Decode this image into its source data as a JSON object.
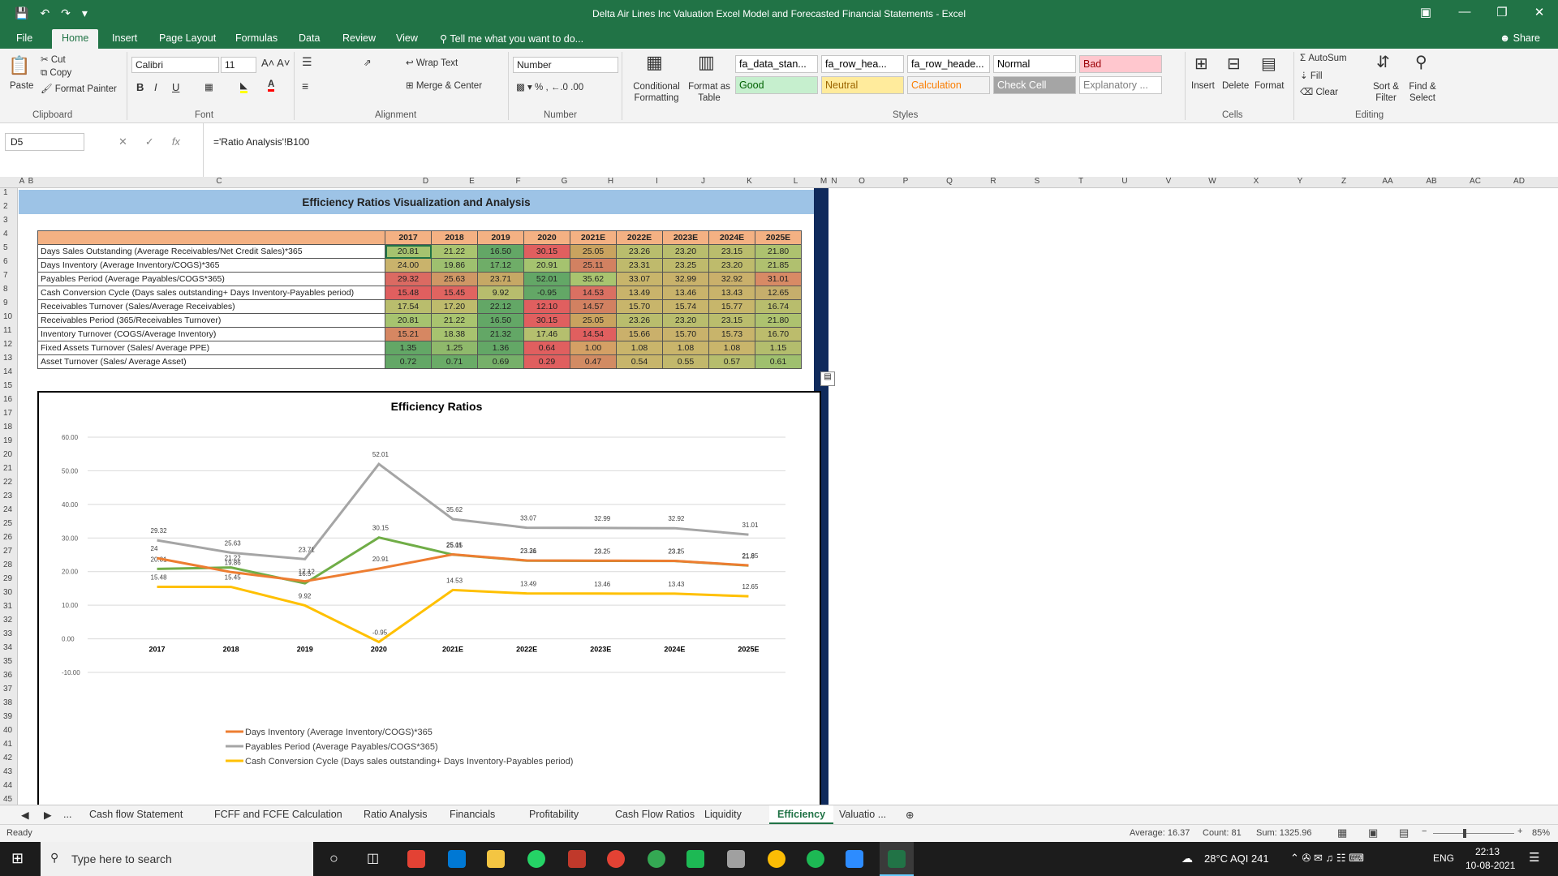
{
  "window": {
    "title": "Delta Air Lines Inc Valuation Excel Model and Forecasted Financial Statements - Excel"
  },
  "ribbon_tabs": [
    "File",
    "Home",
    "Insert",
    "Page Layout",
    "Formulas",
    "Data",
    "Review",
    "View"
  ],
  "tell_me": "Tell me what you want to do...",
  "share": "Share",
  "clipboard": {
    "paste": "Paste",
    "cut": "Cut",
    "copy": "Copy",
    "format_painter": "Format Painter",
    "group": "Clipboard"
  },
  "font": {
    "name": "Calibri",
    "size": "11",
    "group": "Font"
  },
  "alignment": {
    "wrap": "Wrap Text",
    "merge": "Merge & Center",
    "group": "Alignment"
  },
  "number": {
    "format": "Number",
    "group": "Number"
  },
  "styles": {
    "conditional": "Conditional Formatting",
    "format_table": "Format as Table",
    "group": "Styles",
    "cells": [
      {
        "label": "fa_data_stan...",
        "bg": "#ffffff",
        "fg": "#000000"
      },
      {
        "label": "fa_row_hea...",
        "bg": "#ffffff",
        "fg": "#000000"
      },
      {
        "label": "fa_row_heade...",
        "bg": "#ffffff",
        "fg": "#000000"
      },
      {
        "label": "Normal",
        "bg": "#ffffff",
        "fg": "#000000"
      },
      {
        "label": "Bad",
        "bg": "#ffc7ce",
        "fg": "#9c0006"
      },
      {
        "label": "Good",
        "bg": "#c6efce",
        "fg": "#006100"
      },
      {
        "label": "Neutral",
        "bg": "#ffeb9c",
        "fg": "#9c6500"
      },
      {
        "label": "Calculation",
        "bg": "#f2f2f2",
        "fg": "#fa7d00"
      },
      {
        "label": "Check Cell",
        "bg": "#a5a5a5",
        "fg": "#ffffff"
      },
      {
        "label": "Explanatory ...",
        "bg": "#ffffff",
        "fg": "#7f7f7f"
      }
    ]
  },
  "cells_group": {
    "insert": "Insert",
    "delete": "Delete",
    "format": "Format",
    "group": "Cells"
  },
  "editing": {
    "autosum": "AutoSum",
    "fill": "Fill",
    "clear": "Clear",
    "sort": "Sort & Filter",
    "find": "Find & Select",
    "group": "Editing"
  },
  "formula_bar": {
    "name_box": "D5",
    "formula": "='Ratio Analysis'!B100"
  },
  "columns": [
    "A",
    "B",
    "C",
    "D",
    "E",
    "F",
    "G",
    "H",
    "I",
    "J",
    "K",
    "L",
    "M",
    "N",
    "O",
    "P",
    "Q",
    "R",
    "S",
    "T",
    "U",
    "V",
    "W",
    "X",
    "Y",
    "Z",
    "AA",
    "AB",
    "AC",
    "AD"
  ],
  "rows": [
    "1",
    "2",
    "3",
    "4",
    "5",
    "6",
    "7",
    "8",
    "9",
    "10",
    "11",
    "12",
    "13",
    "14",
    "15",
    "16",
    "17",
    "18",
    "19",
    "20",
    "21",
    "22",
    "23",
    "24",
    "25",
    "26",
    "27",
    "28",
    "29",
    "30",
    "31",
    "32",
    "33",
    "34",
    "35",
    "36",
    "37",
    "38",
    "39",
    "40",
    "41",
    "42",
    "43",
    "44",
    "45"
  ],
  "sheet": {
    "banner": "Efficiency Ratios Visualization and Analysis",
    "years": [
      "2017",
      "2018",
      "2019",
      "2020",
      "2021E",
      "2022E",
      "2023E",
      "2024E",
      "2025E"
    ],
    "rows": [
      {
        "label": "Days Sales Outstanding (Average Receivables/Net Credit Sales)*365",
        "values": [
          "20.81",
          "21.22",
          "16.50",
          "30.15",
          "25.05",
          "23.26",
          "23.20",
          "23.15",
          "21.80"
        ],
        "colors": [
          "#a6c36f",
          "#a9c46f",
          "#63a766",
          "#e05f5f",
          "#c9a35f",
          "#b9bd6d",
          "#b9bd6d",
          "#babd6d",
          "#adc26f"
        ]
      },
      {
        "label": "Days Inventory  (Average Inventory/COGS)*365",
        "values": [
          "24.00",
          "19.86",
          "17.12",
          "20.91",
          "25.11",
          "23.31",
          "23.25",
          "23.20",
          "21.85"
        ],
        "colors": [
          "#c9b36c",
          "#9ec06f",
          "#6fad68",
          "#a5c36f",
          "#d28161",
          "#bfba6c",
          "#bfba6c",
          "#bebb6c",
          "#b0c06f"
        ]
      },
      {
        "label": "Payables Period (Average Payables/COGS*365)",
        "values": [
          "29.32",
          "25.63",
          "23.71",
          "52.01",
          "35.62",
          "33.07",
          "32.99",
          "32.92",
          "31.01"
        ],
        "colors": [
          "#db6a62",
          "#cf9765",
          "#c6a865",
          "#63a766",
          "#a9c46f",
          "#c8b56b",
          "#c9b26b",
          "#cab06b",
          "#d88a65"
        ]
      },
      {
        "label": "Cash Conversion Cycle (Days sales outstanding+ Days Inventory-Payables period)",
        "values": [
          "15.48",
          "15.45",
          "9.92",
          "-0.95",
          "14.53",
          "13.49",
          "13.46",
          "13.43",
          "12.65"
        ],
        "colors": [
          "#e05f5f",
          "#e06460",
          "#b7bd6d",
          "#63a766",
          "#da7062",
          "#c9b36b",
          "#c9b36b",
          "#c9b36b",
          "#c6ae6c"
        ]
      },
      {
        "label": "Receivables Turnover (Sales/Average Receivables)",
        "values": [
          "17.54",
          "17.20",
          "22.12",
          "12.10",
          "14.57",
          "15.70",
          "15.74",
          "15.77",
          "16.74"
        ],
        "colors": [
          "#b9bd6d",
          "#bebb6c",
          "#63a766",
          "#e05f5f",
          "#d28161",
          "#c8b56b",
          "#c8b56b",
          "#c7b66b",
          "#b8bd6d"
        ]
      },
      {
        "label": "Receivables Period (365/Receivables Turnover)",
        "values": [
          "20.81",
          "21.22",
          "16.50",
          "30.15",
          "25.05",
          "23.26",
          "23.20",
          "23.15",
          "21.80"
        ],
        "colors": [
          "#a6c36f",
          "#a9c46f",
          "#63a766",
          "#e05f5f",
          "#c9a35f",
          "#b9bd6d",
          "#b9bd6d",
          "#babd6d",
          "#adc26f"
        ]
      },
      {
        "label": "Inventory Turnover (COGS/Average Inventory)",
        "values": [
          "15.21",
          "18.38",
          "21.32",
          "17.46",
          "14.54",
          "15.66",
          "15.70",
          "15.73",
          "16.70"
        ],
        "colors": [
          "#d68762",
          "#a7c36f",
          "#63a766",
          "#b5bf6e",
          "#e05f5f",
          "#cab06b",
          "#c9b26b",
          "#c8b46b",
          "#bcbc6c"
        ]
      },
      {
        "label": "Fixed Assets Turnover (Sales/ Average PPE)",
        "values": [
          "1.35",
          "1.25",
          "1.36",
          "0.64",
          "1.00",
          "1.08",
          "1.08",
          "1.08",
          "1.15"
        ],
        "colors": [
          "#63a766",
          "#8fb96b",
          "#63a766",
          "#e05f5f",
          "#d4a065",
          "#c9b56b",
          "#c9b56b",
          "#c9b56b",
          "#b3bd6d"
        ]
      },
      {
        "label": "Asset Turnover (Sales/ Average Asset)",
        "values": [
          "0.72",
          "0.71",
          "0.69",
          "0.29",
          "0.47",
          "0.54",
          "0.55",
          "0.57",
          "0.61"
        ],
        "colors": [
          "#63a766",
          "#6aab67",
          "#76b069",
          "#e05f5f",
          "#d28b63",
          "#c7b56b",
          "#c2b86c",
          "#b6bd6d",
          "#9fc06e"
        ]
      }
    ]
  },
  "chart_data": {
    "type": "line",
    "title": "Efficiency Ratios",
    "categories": [
      "2017",
      "2018",
      "2019",
      "2020",
      "2021E",
      "2022E",
      "2023E",
      "2024E",
      "2025E"
    ],
    "ylim": [
      -10,
      60
    ],
    "yticks": [
      "60.00",
      "50.00",
      "40.00",
      "30.00",
      "20.00",
      "10.00",
      "0.00",
      "-10.00"
    ],
    "grid": true,
    "legend_position": "bottom",
    "series": [
      {
        "name": "",
        "color": "#70ad47",
        "values": [
          20.81,
          21.22,
          16.5,
          30.15,
          25.05,
          23.26,
          23.2,
          23.15,
          21.8
        ]
      },
      {
        "name": "Days Inventory  (Average Inventory/COGS)*365",
        "color": "#ed7d31",
        "values": [
          24.0,
          19.86,
          17.12,
          20.91,
          25.11,
          23.31,
          23.25,
          23.2,
          21.85
        ]
      },
      {
        "name": "Payables Period (Average Payables/COGS*365)",
        "color": "#a5a5a5",
        "values": [
          29.32,
          25.63,
          23.71,
          52.01,
          35.62,
          33.07,
          32.99,
          32.92,
          31.01
        ]
      },
      {
        "name": "Cash Conversion Cycle (Days sales outstanding+ Days Inventory-Payables period)",
        "color": "#ffc000",
        "values": [
          15.48,
          15.45,
          9.92,
          -0.95,
          14.53,
          13.49,
          13.46,
          13.43,
          12.65
        ]
      }
    ]
  },
  "sheet_tabs": [
    "...",
    "Cash flow Statement",
    "FCFF and FCFE Calculation",
    "Ratio Analysis",
    "Financials",
    "Profitability",
    "Cash Flow Ratios",
    "Liquidity",
    "Efficiency",
    "Valuatio ..."
  ],
  "status": {
    "ready": "Ready",
    "average": "Average: 16.37",
    "count": "Count: 81",
    "sum": "Sum: 1325.96",
    "zoom": "85%"
  },
  "taskbar": {
    "search": "Type here to search",
    "weather": "28°C  AQI 241",
    "lang": "ENG",
    "time": "22:13",
    "date": "10-08-2021"
  }
}
